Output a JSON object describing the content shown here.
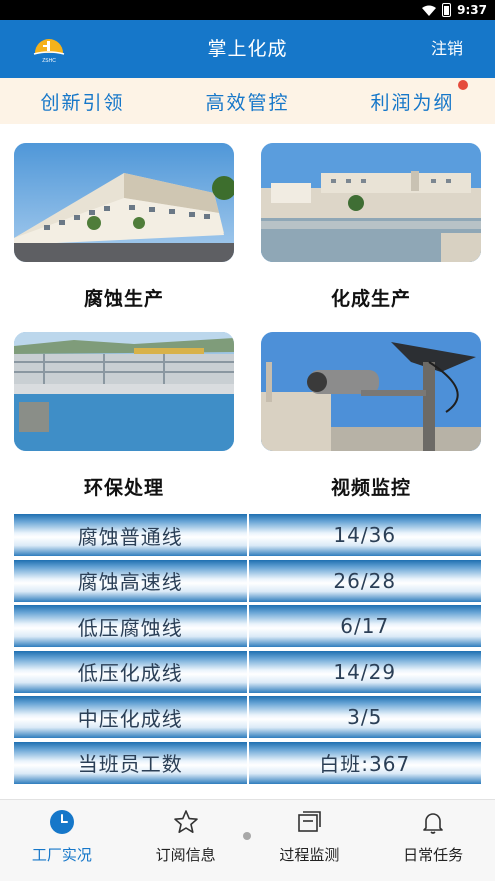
{
  "status_bar": {
    "time": "9:37",
    "battery": "8"
  },
  "header": {
    "title": "掌上化成",
    "logout_label": "注销",
    "logo_text": "ZSHC"
  },
  "slogans": [
    "创新引领",
    "高效管控",
    "利润为纲"
  ],
  "cards": [
    {
      "label": "腐蚀生产",
      "image": "factory-building"
    },
    {
      "label": "化成生产",
      "image": "plant-with-water"
    },
    {
      "label": "环保处理",
      "image": "water-treatment-pool"
    },
    {
      "label": "视频监控",
      "image": "surveillance-camera"
    }
  ],
  "lines_table": [
    {
      "name": "腐蚀普通线",
      "value": "14/36"
    },
    {
      "name": "腐蚀高速线",
      "value": "26/28"
    },
    {
      "name": "低压腐蚀线",
      "value": "6/17"
    },
    {
      "name": "低压化成线",
      "value": "14/29"
    },
    {
      "name": "中压化成线",
      "value": "3/5"
    },
    {
      "name": "当班员工数",
      "value": "白班:367"
    }
  ],
  "bottom_nav": [
    {
      "label": "工厂实况",
      "icon": "clock-icon",
      "active": true
    },
    {
      "label": "订阅信息",
      "icon": "star-icon",
      "active": false
    },
    {
      "label": "过程监测",
      "icon": "window-icon",
      "active": false
    },
    {
      "label": "日常任务",
      "icon": "bell-icon",
      "active": false
    }
  ],
  "colors": {
    "primary": "#1677c9",
    "slogan_bg": "#fdf3e6",
    "badge": "#e54b3c"
  }
}
